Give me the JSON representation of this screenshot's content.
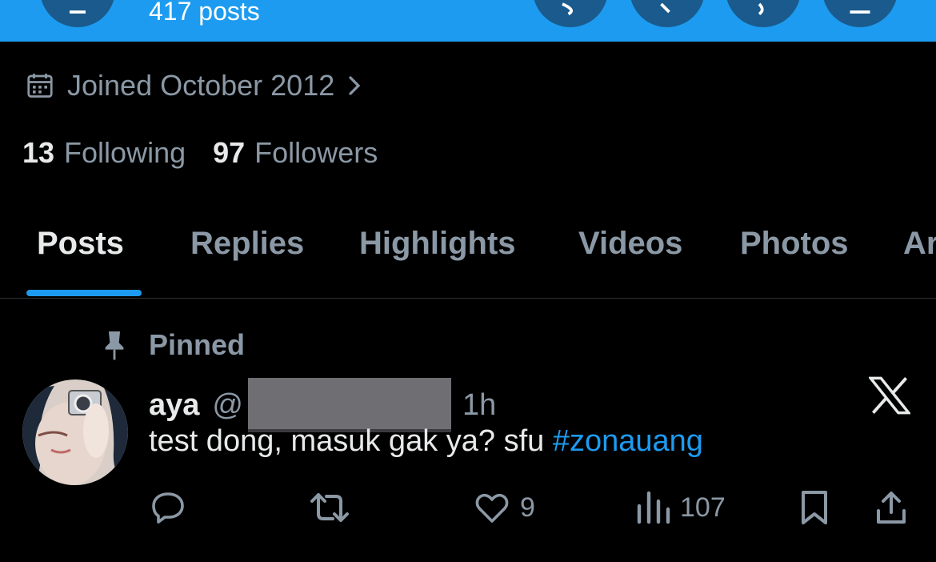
{
  "header": {
    "posts_count": "417 posts"
  },
  "profile": {
    "joined": "Joined October 2012",
    "following_count": "13",
    "following_label": "Following",
    "followers_count": "97",
    "followers_label": "Followers"
  },
  "tabs": [
    {
      "label": "Posts",
      "active": true
    },
    {
      "label": "Replies"
    },
    {
      "label": "Highlights"
    },
    {
      "label": "Videos"
    },
    {
      "label": "Photos"
    },
    {
      "label": "Ar"
    }
  ],
  "post": {
    "pinned_label": "Pinned",
    "author_name": "aya",
    "handle_prefix": "@",
    "time": "1h",
    "text": "test dong, masuk gak ya? sfu ",
    "hashtag": "#zonauang",
    "likes": "9",
    "views": "107"
  },
  "icons": [
    "back-arrow-icon",
    "grok-icon",
    "search-icon",
    "message-icon",
    "share-icon",
    "calendar-icon",
    "chevron-right-icon",
    "pin-icon",
    "x-logo-icon",
    "reply-icon",
    "repost-icon",
    "like-icon",
    "views-icon",
    "bookmark-icon",
    "share-icon"
  ],
  "colors": {
    "accent": "#1d9bf0",
    "background": "#000000",
    "muted_text": "#8b98a5"
  }
}
